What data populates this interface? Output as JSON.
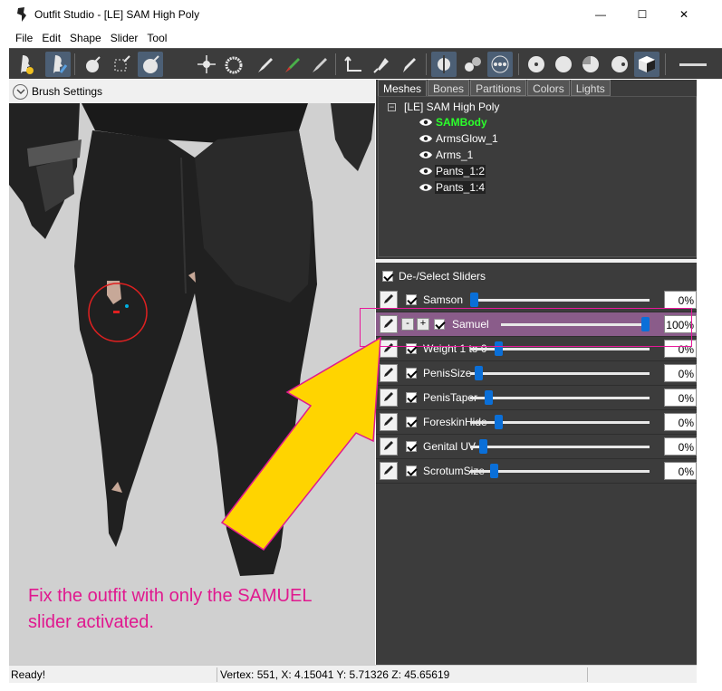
{
  "window": {
    "title": "Outfit Studio - [LE] SAM High Poly",
    "minimize_glyph": "—",
    "maximize_glyph": "☐",
    "close_glyph": "✕"
  },
  "menu": [
    "File",
    "Edit",
    "Shape",
    "Slider",
    "Tool"
  ],
  "brush_settings": {
    "label": "Brush Settings"
  },
  "tabs": [
    "Meshes",
    "Bones",
    "Partitions",
    "Colors",
    "Lights"
  ],
  "active_tab": "Meshes",
  "mesh_tree": {
    "root": "[LE] SAM High Poly",
    "collapse_glyph": "−",
    "meshes": [
      {
        "name": "SAMBody",
        "state": "active"
      },
      {
        "name": "ArmsGlow_1",
        "state": "normal"
      },
      {
        "name": "Arms_1",
        "state": "normal"
      },
      {
        "name": "Pants_1:2",
        "state": "selected"
      },
      {
        "name": "Pants_1:4",
        "state": "selected"
      }
    ]
  },
  "sliders_header": {
    "label": "De-/Select Sliders",
    "checked": true
  },
  "sliders": [
    {
      "name": "Samson",
      "value": "0%",
      "level": 0,
      "checked": true,
      "highlighted": false
    },
    {
      "name": "Samuel",
      "value": "100%",
      "level": 1,
      "checked": true,
      "highlighted": true,
      "minus": "-",
      "plus": "+"
    },
    {
      "name": "Weight 1 to 0",
      "value": "0%",
      "level": 0,
      "checked": true,
      "highlighted": false
    },
    {
      "name": "PenisSize",
      "value": "0%",
      "level": 0,
      "checked": true,
      "highlighted": false
    },
    {
      "name": "PenisTaper",
      "value": "0%",
      "level": 0,
      "checked": true,
      "highlighted": false
    },
    {
      "name": "ForeskinHide",
      "value": "0%",
      "level": 0,
      "checked": true,
      "highlighted": false
    },
    {
      "name": "Genital UV",
      "value": "0%",
      "level": 0,
      "checked": true,
      "highlighted": false
    },
    {
      "name": "ScrotumSize",
      "value": "0%",
      "level": 0,
      "checked": true,
      "highlighted": false
    }
  ],
  "status": {
    "left": "Ready!",
    "vertex": "Vertex: 551, X: 4.15041 Y: 5.71326 Z: 45.65619"
  },
  "annotation": {
    "line1": "Fix the outfit with only the SAMUEL",
    "line2": "slider activated.",
    "color": "#e0198f"
  },
  "colors": {
    "panel_dark": "#3c3c3c",
    "active_mesh": "#2bff2b",
    "slider_highlight": "#8a5c8a",
    "slider_thumb": "#0a6fd8",
    "arrow_fill": "#ffd400"
  }
}
